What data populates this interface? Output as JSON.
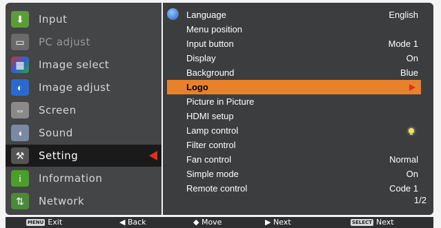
{
  "left_menu": [
    {
      "label": "Input",
      "icon": "input-icon",
      "state": "normal"
    },
    {
      "label": "PC adjust",
      "icon": "pc-adjust-icon",
      "state": "disabled"
    },
    {
      "label": "Image select",
      "icon": "image-select-icon",
      "state": "normal"
    },
    {
      "label": "Image adjust",
      "icon": "image-adjust-icon",
      "state": "normal"
    },
    {
      "label": "Screen",
      "icon": "screen-icon",
      "state": "normal"
    },
    {
      "label": "Sound",
      "icon": "sound-icon",
      "state": "normal"
    },
    {
      "label": "Setting",
      "icon": "setting-icon",
      "state": "selected"
    },
    {
      "label": "Information",
      "icon": "information-icon",
      "state": "normal"
    },
    {
      "label": "Network",
      "icon": "network-icon",
      "state": "normal"
    }
  ],
  "settings": [
    {
      "name": "Language",
      "value": "English"
    },
    {
      "name": "Menu position",
      "value": ""
    },
    {
      "name": "Input button",
      "value": "Mode 1"
    },
    {
      "name": "Display",
      "value": "On"
    },
    {
      "name": "Background",
      "value": "Blue"
    },
    {
      "name": "Logo",
      "value": ""
    },
    {
      "name": "Picture in Picture",
      "value": ""
    },
    {
      "name": "HDMI setup",
      "value": ""
    },
    {
      "name": "Lamp control",
      "value": ""
    },
    {
      "name": "Filter control",
      "value": ""
    },
    {
      "name": "Fan control",
      "value": "Normal"
    },
    {
      "name": "Simple mode",
      "value": "On"
    },
    {
      "name": "Remote control",
      "value": "Code 1"
    }
  ],
  "page_indicator": "1/2",
  "bottom_bar": {
    "menu_key": "MENU",
    "exit": "Exit",
    "back": "◀ Back",
    "move": "◆ Move",
    "next_arrow": "▶ Next",
    "select_key": "SELECT",
    "next": "Next"
  },
  "colors": {
    "highlight": "#e8822a",
    "pointer": "#e03020",
    "panel": "#444546"
  }
}
